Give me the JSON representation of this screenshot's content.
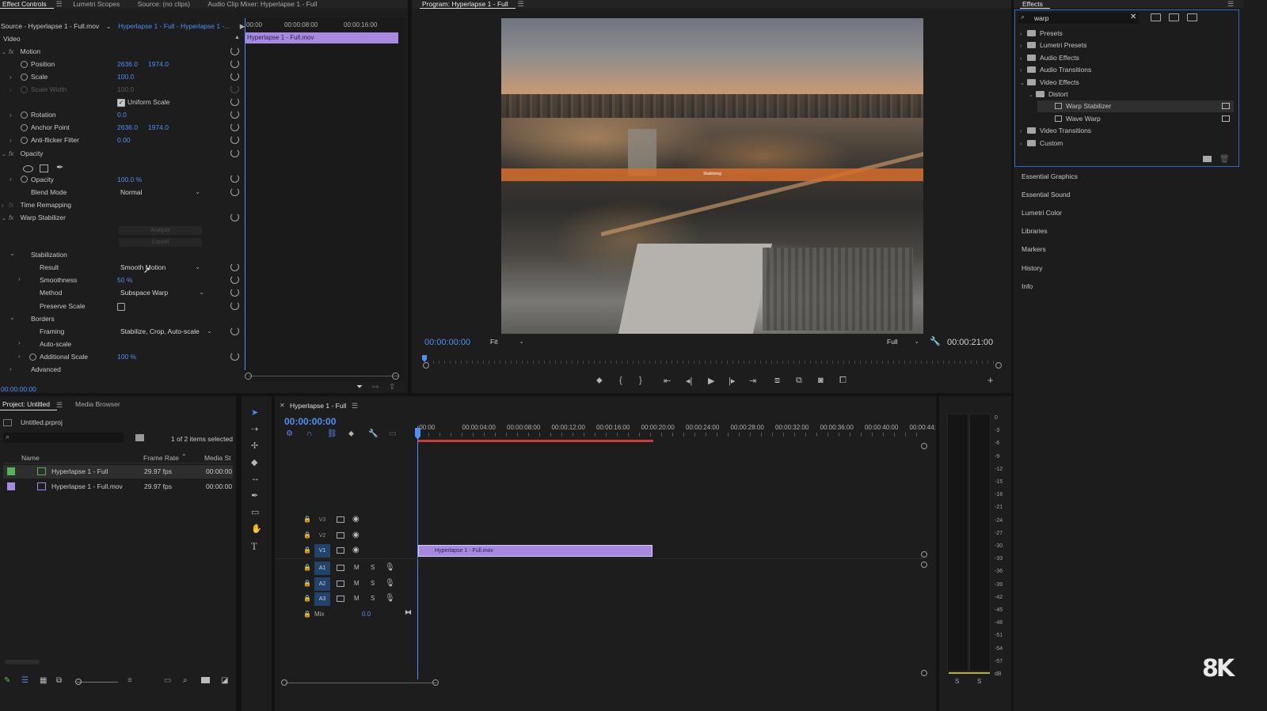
{
  "effect_controls": {
    "tabs": [
      "Effect Controls",
      "Lumetri Scopes",
      "Source: (no clips)",
      "Audio Clip Mixer: Hyperlapse 1 - Full"
    ],
    "source_label": "Source - Hyperlapse 1 - Full.mov",
    "sequence_label": "Hyperlapse 1 - Full - Hyperlapse 1 -...",
    "mini_ruler": [
      "00:00",
      "00:00:08:00",
      "00:00:16:00"
    ],
    "clip_bar": "Hyperlapse 1 - Full.mov",
    "section": "Video",
    "motion": "Motion",
    "position": {
      "label": "Position",
      "x": "2636.0",
      "y": "1974.0"
    },
    "scale": {
      "label": "Scale",
      "value": "100.0"
    },
    "scale_width": {
      "label": "Scale Width",
      "value": "100.0"
    },
    "uniform_scale": "Uniform Scale",
    "rotation": {
      "label": "Rotation",
      "value": "0.0"
    },
    "anchor": {
      "label": "Anchor Point",
      "x": "2636.0",
      "y": "1974.0"
    },
    "antiflicker": {
      "label": "Anti-flicker Filter",
      "value": "0.00"
    },
    "opacity_group": "Opacity",
    "opacity": {
      "label": "Opacity",
      "value": "100.0 %"
    },
    "blend": {
      "label": "Blend Mode",
      "value": "Normal"
    },
    "time_remap": "Time Remapping",
    "warp": "Warp Stabilizer",
    "analyze": "Analyze",
    "cancel": "Cancel",
    "stabilization": "Stabilization",
    "result": {
      "label": "Result",
      "value": "Smooth Motion"
    },
    "smoothness": {
      "label": "Smoothness",
      "value": "50 %"
    },
    "method": {
      "label": "Method",
      "value": "Subspace Warp"
    },
    "preserve": "Preserve Scale",
    "borders": "Borders",
    "framing": {
      "label": "Framing",
      "value": "Stabilize, Crop, Auto-scale"
    },
    "autoscale": "Auto-scale",
    "addscale": {
      "label": "Additional Scale",
      "value": "100 %"
    },
    "advanced": "Advanced",
    "timecode": "00:00:00:00"
  },
  "program": {
    "title": "Program: Hyperlapse 1 - Full",
    "overlay": "Stabilizing",
    "timecode": "00:00:00:00",
    "fit": "Fit",
    "full": "Full",
    "duration": "00:00:21:00"
  },
  "effects": {
    "title": "Effects",
    "search": "warp",
    "items": [
      {
        "label": "Presets",
        "level": 0,
        "open": false
      },
      {
        "label": "Lumetri Presets",
        "level": 0,
        "open": false
      },
      {
        "label": "Audio Effects",
        "level": 0,
        "open": false
      },
      {
        "label": "Audio Transitions",
        "level": 0,
        "open": false
      },
      {
        "label": "Video Effects",
        "level": 0,
        "open": true
      },
      {
        "label": "Distort",
        "level": 1,
        "open": true
      },
      {
        "label": "Warp Stabilizer",
        "level": 2,
        "selected": true
      },
      {
        "label": "Wave Warp",
        "level": 2
      },
      {
        "label": "Video Transitions",
        "level": 0,
        "open": false
      },
      {
        "label": "Custom",
        "level": 0,
        "open": false
      }
    ],
    "side_panels": [
      "Essential Graphics",
      "Essential Sound",
      "Lumetri Color",
      "Libraries",
      "Markers",
      "History",
      "Info"
    ]
  },
  "project": {
    "tabs": [
      "Project: Untitled",
      "Media Browser"
    ],
    "file": "Untitled.prproj",
    "items_selected": "1 of 2 items selected",
    "columns": [
      "Name",
      "Frame Rate",
      "Media St"
    ],
    "rows": [
      {
        "name": "Hyperlapse 1 - Full",
        "fps": "29.97 fps",
        "start": "00:00:00",
        "color": "#54b35a"
      },
      {
        "name": "Hyperlapse 1 - Full.mov",
        "fps": "29.97 fps",
        "start": "00:00:00",
        "color": "#a58be0"
      }
    ]
  },
  "timeline": {
    "tab": "Hyperlapse 1 - Full",
    "timecode": "00:00:00:00",
    "ruler": [
      ":00:00",
      "00:00:04:00",
      "00:00:08:00",
      "00:00:12:00",
      "00:00:16:00",
      "00:00:20:00",
      "00:00:24:00",
      "00:00:28:00",
      "00:00:32:00",
      "00:00:36:00",
      "00:00:40:00",
      "00:00:44:"
    ],
    "video_tracks": [
      "V3",
      "V2",
      "V1"
    ],
    "audio_tracks": [
      "A1",
      "A2",
      "A3"
    ],
    "mix": "Mix",
    "mix_value": "0.0",
    "clip": "Hyperlapse 1 - Full.mov"
  },
  "meter": {
    "scale": [
      "0",
      "-3",
      "-6",
      "-9",
      "-12",
      "-15",
      "-18",
      "-21",
      "-24",
      "-27",
      "-30",
      "-33",
      "-36",
      "-39",
      "-42",
      "-45",
      "-48",
      "-51",
      "-54",
      "-57",
      "dB"
    ],
    "solo": [
      "S",
      "S"
    ]
  },
  "watermark": "8K"
}
